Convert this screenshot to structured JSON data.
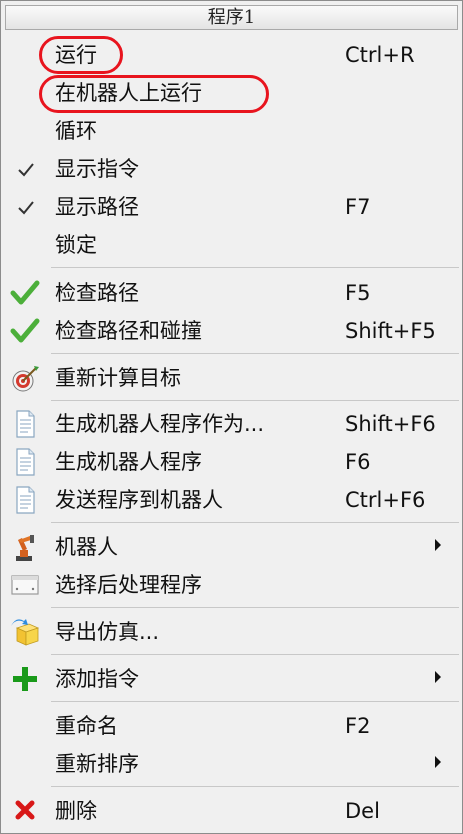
{
  "menu": {
    "title": "程序1",
    "items": [
      {
        "label": "运行",
        "shortcut": "Ctrl+R"
      },
      {
        "label": "在机器人上运行",
        "shortcut": ""
      },
      {
        "label": "循环",
        "shortcut": ""
      },
      {
        "label": "显示指令",
        "shortcut": "",
        "checked": true
      },
      {
        "label": "显示路径",
        "shortcut": "F7",
        "checked": true
      },
      {
        "label": "锁定",
        "shortcut": ""
      },
      {
        "label": "检查路径",
        "shortcut": "F5",
        "icon": "green-check-icon"
      },
      {
        "label": "检查路径和碰撞",
        "shortcut": "Shift+F5",
        "icon": "green-check-icon"
      },
      {
        "label": "重新计算目标",
        "shortcut": "",
        "icon": "target-icon"
      },
      {
        "label": "生成机器人程序作为...",
        "shortcut": "Shift+F6",
        "icon": "document-icon"
      },
      {
        "label": "生成机器人程序",
        "shortcut": "F6",
        "icon": "document-icon"
      },
      {
        "label": "发送程序到机器人",
        "shortcut": "Ctrl+F6",
        "icon": "document-icon"
      },
      {
        "label": "机器人",
        "shortcut": "",
        "submenu": true,
        "icon": "robot-arm-icon"
      },
      {
        "label": "选择后处理程序",
        "shortcut": "",
        "icon": "post-processor-icon"
      },
      {
        "label": "导出仿真...",
        "shortcut": "",
        "icon": "export-box-icon"
      },
      {
        "label": "添加指令",
        "shortcut": "",
        "submenu": true,
        "icon": "plus-icon"
      },
      {
        "label": "重命名",
        "shortcut": "F2"
      },
      {
        "label": "重新排序",
        "shortcut": "",
        "submenu": true
      },
      {
        "label": "删除",
        "shortcut": "Del",
        "icon": "red-x-icon"
      }
    ]
  },
  "colors": {
    "highlight_ring": "#e8141e",
    "check_green": "#4caf3a",
    "plus_green": "#1a9a1a",
    "delete_red": "#d81818"
  }
}
